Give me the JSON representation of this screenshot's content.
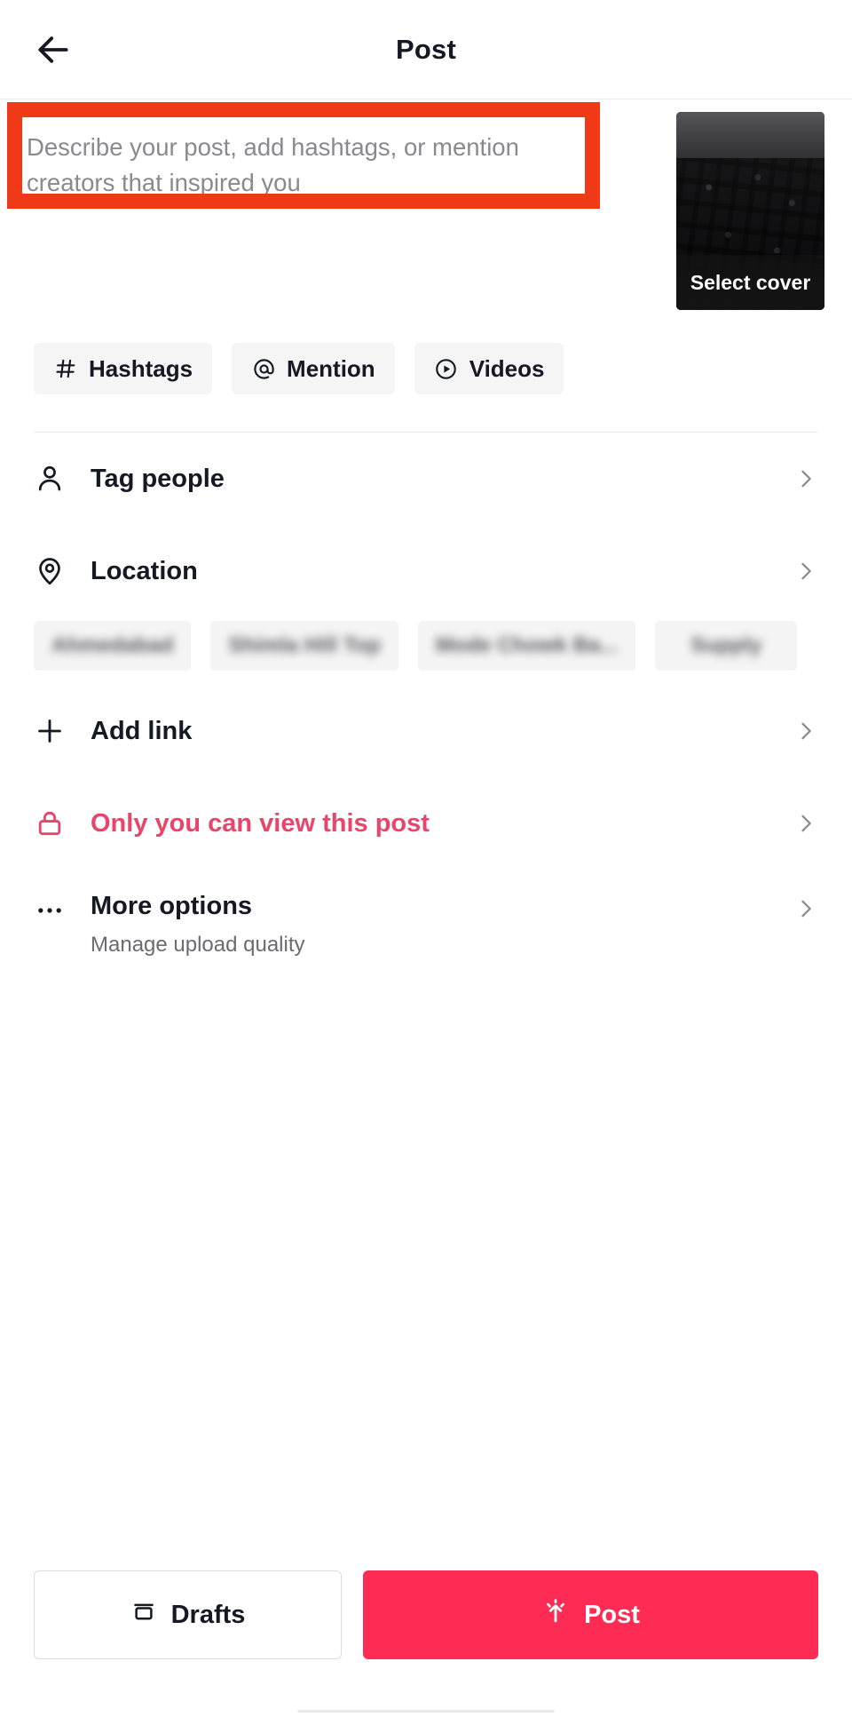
{
  "header": {
    "title": "Post",
    "back_icon": "arrow-left-icon"
  },
  "compose": {
    "caption_value": "",
    "caption_placeholder": "Describe your post, add hashtags, or mention creators that inspired you",
    "cover": {
      "label": "Select cover",
      "thumbnail_alt": "keyboard-video-frame"
    },
    "annotation": {
      "color": "#f03a17",
      "target": "caption-input"
    }
  },
  "chips": [
    {
      "icon": "hashtag-icon",
      "glyph": "#",
      "label": "Hashtags"
    },
    {
      "icon": "at-mention-icon",
      "glyph": "@",
      "label": "Mention"
    },
    {
      "icon": "play-circle-icon",
      "glyph": "",
      "label": "Videos"
    }
  ],
  "options": [
    {
      "key": "tag_people",
      "icon": "person-icon",
      "label": "Tag people",
      "sub": "",
      "chevron": "chevron-right-icon",
      "danger": false
    },
    {
      "key": "location",
      "icon": "location-pin-icon",
      "label": "Location",
      "sub": "",
      "chevron": "chevron-right-icon",
      "danger": false
    },
    {
      "key": "add_link",
      "icon": "plus-icon",
      "label": "Add link",
      "sub": "",
      "chevron": "chevron-right-icon",
      "danger": false
    },
    {
      "key": "privacy",
      "icon": "lock-icon",
      "label": "Only you can view this post",
      "sub": "",
      "chevron": "chevron-right-icon",
      "danger": true
    },
    {
      "key": "more_options",
      "icon": "ellipsis-icon",
      "label": "More options",
      "sub": "Manage upload quality",
      "chevron": "chevron-right-icon",
      "danger": false
    }
  ],
  "location_suggestions": [
    {
      "label": "Ahmedabad",
      "redacted": true
    },
    {
      "label": "Shimla Hill Top",
      "redacted": true
    },
    {
      "label": "Mode Chowk Ba...",
      "redacted": true
    },
    {
      "label": "Supply",
      "redacted": true
    }
  ],
  "footer": {
    "drafts_label": "Drafts",
    "drafts_icon": "archive-box-icon",
    "post_label": "Post",
    "post_icon": "upload-sparkle-icon",
    "post_color": "#fe2c55"
  },
  "colors": {
    "accent": "#fe2c55",
    "danger_text": "#e8456b",
    "annotation": "#f03a17",
    "text_primary": "#161823",
    "text_secondary": "#6b6b70",
    "placeholder": "#8a8a8e",
    "chip_bg": "#f5f5f5",
    "divider": "#ebebeb"
  }
}
